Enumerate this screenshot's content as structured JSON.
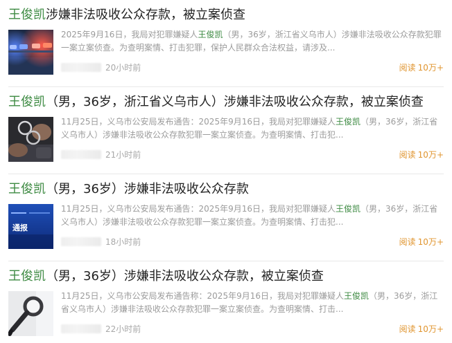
{
  "results": [
    {
      "title_name": "王俊凯",
      "title_rest": "涉嫌非法吸收公众存款，被立案侦查",
      "summary_before": "2025年9月16日，我局对犯罪嫌疑人",
      "summary_name": "王俊凯",
      "summary_after": "（男，36岁，浙江省义乌市人）涉嫌非法吸收公众存款犯罪一案立案侦查。为查明案情、打击犯罪，保护人民群众合法权益，请涉及...",
      "time": "20小时前",
      "reads_label": "阅读",
      "reads_count": "10万+",
      "thumb": "police-lights-image"
    },
    {
      "title_name": "王俊凯",
      "title_rest": "（男，36岁，浙江省义乌市人）涉嫌非法吸收公众存款，被立案侦查",
      "summary_before": "11月25日，义乌市公安局发布通告：2025年9月16日，我局对犯罪嫌疑人",
      "summary_name": "王俊凯",
      "summary_after": "（男，36岁，浙江省义乌市人）涉嫌非法吸收公众存款犯罪一案立案侦查。为查明案情、打击犯...",
      "time": "21小时前",
      "reads_label": "阅读",
      "reads_count": "10万+",
      "thumb": "handcuffs-image"
    },
    {
      "title_name": "王俊凯",
      "title_rest": "（男，36岁）涉嫌非法吸收公众存款",
      "summary_before": "11月25日，义乌市公安局发布通告：2025年9月16日，我局对犯罪嫌疑人",
      "summary_name": "王俊凯",
      "summary_after": "（男，36岁，浙江省义乌市人）涉嫌非法吸收公众存款犯罪一案立案侦查。为查明案情、打击犯...",
      "time": "18小时前",
      "reads_label": "阅读",
      "reads_count": "10万+",
      "thumb": "notice-image",
      "thumb_text": "通报"
    },
    {
      "title_name": "王俊凯",
      "title_rest": "（男，36岁）涉嫌非法吸收公众存款，被立案侦查",
      "summary_before": "11月25日，义乌市公安局发布通告称：2025年9月16日，我局对犯罪嫌疑人",
      "summary_name": "王俊凯",
      "summary_after": "（男，36岁，浙江省义乌市人）涉嫌非法吸收公众存款犯罪一案立案侦查。为查明案情、打击...",
      "time": "22小时前",
      "reads_label": "阅读",
      "reads_count": "10万+",
      "thumb": "magnifier-image"
    }
  ]
}
